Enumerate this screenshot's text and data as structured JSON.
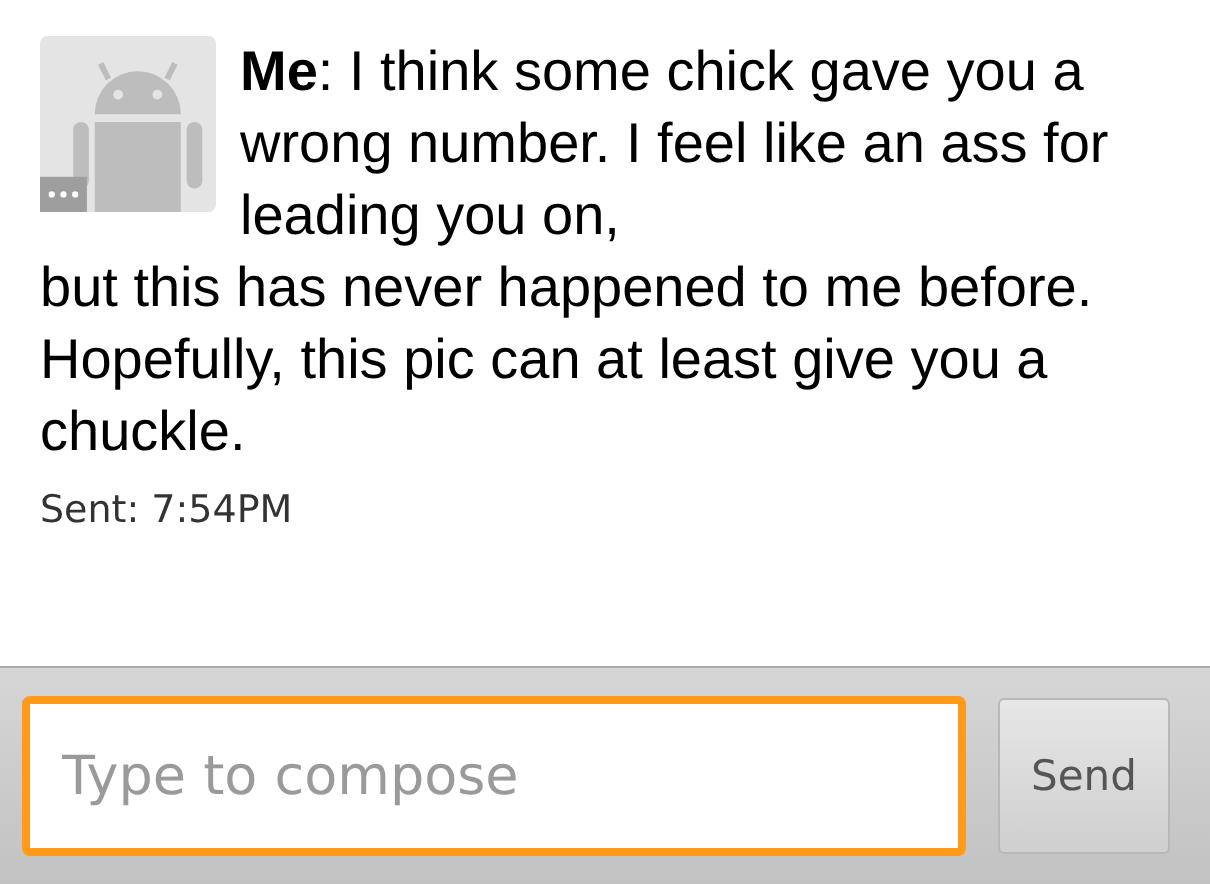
{
  "message": {
    "text_parts": [
      "**Me**: I think some chick gave you a wrong number. I feel like an ass for leading you on,",
      "but this has never happened to me before. Hopefully, this pic can at least give you a chuckle."
    ],
    "sent": "Sent: 7:54PM"
  },
  "compose": {
    "placeholder": "Type to compose"
  },
  "send_button": {
    "label": "Send"
  }
}
